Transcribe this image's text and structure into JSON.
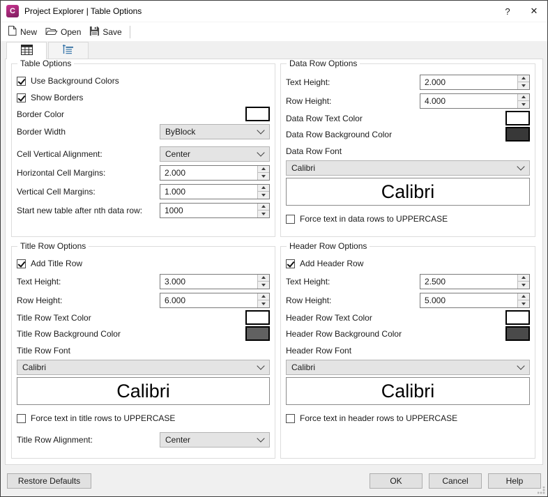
{
  "window": {
    "title": "Project Explorer | Table Options",
    "app_icon_letter": "C",
    "help_glyph": "?",
    "close_glyph": "✕"
  },
  "toolbar": {
    "new_label": "New",
    "open_label": "Open",
    "save_label": "Save"
  },
  "groups": {
    "table_options": {
      "title": "Table Options",
      "use_background_colors": {
        "label": "Use Background Colors",
        "checked": true
      },
      "show_borders": {
        "label": "Show Borders",
        "checked": true
      },
      "border_color": {
        "label": "Border Color",
        "color": "#ffffff"
      },
      "border_width": {
        "label": "Border Width",
        "value": "ByBlock"
      },
      "cell_vertical_alignment": {
        "label": "Cell Vertical Alignment:",
        "value": "Center"
      },
      "horizontal_cell_margins": {
        "label": "Horizontal Cell Margins:",
        "value": "2.000"
      },
      "vertical_cell_margins": {
        "label": "Vertical Cell Margins:",
        "value": "1.000"
      },
      "start_new_table": {
        "label": "Start new table after nth data row:",
        "value": "1000"
      }
    },
    "data_row_options": {
      "title": "Data Row Options",
      "text_height": {
        "label": "Text Height:",
        "value": "2.000"
      },
      "row_height": {
        "label": "Row Height:",
        "value": "4.000"
      },
      "text_color": {
        "label": "Data Row Text Color",
        "color": "#ffffff"
      },
      "background_color": {
        "label": "Data Row Background Color",
        "color": "#383838"
      },
      "font": {
        "label": "Data Row Font",
        "value": "Calibri",
        "preview": "Calibri"
      },
      "uppercase": {
        "label": "Force text in data rows to UPPERCASE",
        "checked": false
      }
    },
    "title_row_options": {
      "title": "Title Row Options",
      "add_row": {
        "label": "Add Title Row",
        "checked": true
      },
      "text_height": {
        "label": "Text Height:",
        "value": "3.000"
      },
      "row_height": {
        "label": "Row Height:",
        "value": "6.000"
      },
      "text_color": {
        "label": "Title Row Text Color",
        "color": "#ffffff"
      },
      "background_color": {
        "label": "Title Row Background Color",
        "color": "#616161"
      },
      "font": {
        "label": "Title Row Font",
        "value": "Calibri",
        "preview": "Calibri"
      },
      "uppercase": {
        "label": "Force text in title rows to UPPERCASE",
        "checked": false
      },
      "alignment": {
        "label": "Title Row Alignment:",
        "value": "Center"
      }
    },
    "header_row_options": {
      "title": "Header Row Options",
      "add_row": {
        "label": "Add Header Row",
        "checked": true
      },
      "text_height": {
        "label": "Text Height:",
        "value": "2.500"
      },
      "row_height": {
        "label": "Row Height:",
        "value": "5.000"
      },
      "text_color": {
        "label": "Header Row Text Color",
        "color": "#ffffff"
      },
      "background_color": {
        "label": "Header Row Background Color",
        "color": "#4a4a4a"
      },
      "font": {
        "label": "Header Row Font",
        "value": "Calibri",
        "preview": "Calibri"
      },
      "uppercase": {
        "label": "Force text in header rows to UPPERCASE",
        "checked": false
      }
    }
  },
  "footer": {
    "restore_defaults": "Restore Defaults",
    "ok": "OK",
    "cancel": "Cancel",
    "help": "Help"
  }
}
